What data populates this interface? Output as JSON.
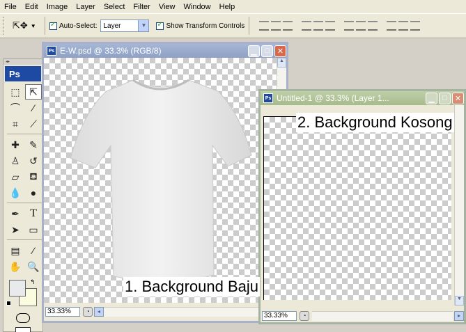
{
  "menu": {
    "items": [
      "File",
      "Edit",
      "Image",
      "Layer",
      "Select",
      "Filter",
      "View",
      "Window",
      "Help"
    ]
  },
  "options": {
    "auto_select_label": "Auto-Select:",
    "auto_select_value": "Layer",
    "show_transform_label": "Show Transform Controls"
  },
  "toolbox": {
    "logo": "Ps",
    "tool_icons": [
      "marquee-icon",
      "move-icon",
      "lasso-icon",
      "magic-wand-icon",
      "crop-icon",
      "slice-icon",
      "healing-icon",
      "brush-icon",
      "stamp-icon",
      "history-brush-icon",
      "eraser-icon",
      "bucket-icon",
      "blur-icon",
      "dodge-icon",
      "pen-icon",
      "type-icon",
      "path-select-icon",
      "shape-icon",
      "notes-icon",
      "eyedropper-icon",
      "hand-icon",
      "zoom-icon"
    ],
    "foreground_color": "#e9eaeb",
    "background_color": "#fbfbe0"
  },
  "windows": {
    "doc1": {
      "title": "E-W.psd @ 33.3% (RGB/8)",
      "zoom": "33.33%",
      "annotation": "1. Background Baju"
    },
    "doc2": {
      "title": "Untitled-1 @ 33.3% (Layer 1...",
      "zoom": "33.33%",
      "annotation": "2. Background Kosong"
    }
  }
}
